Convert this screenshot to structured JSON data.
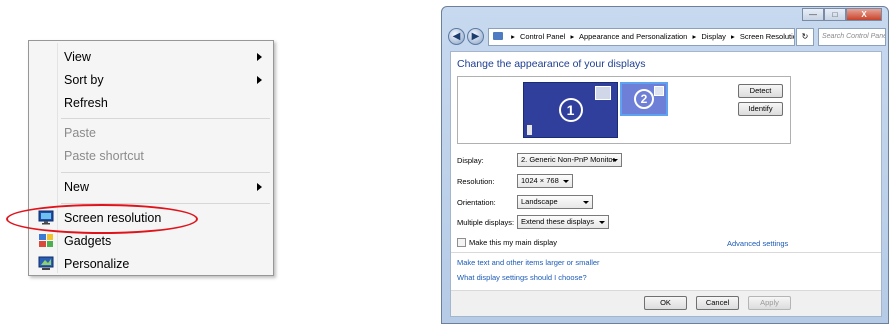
{
  "context_menu": {
    "items": [
      {
        "label": "View",
        "submenu": true
      },
      {
        "label": "Sort by",
        "submenu": true
      },
      {
        "label": "Refresh"
      },
      {
        "label": "Paste",
        "disabled": true
      },
      {
        "label": "Paste shortcut",
        "disabled": true
      },
      {
        "label": "New",
        "submenu": true
      },
      {
        "label": "Screen resolution",
        "icon": "screen-resolution-icon"
      },
      {
        "label": "Gadgets",
        "icon": "gadgets-icon"
      },
      {
        "label": "Personalize",
        "icon": "personalize-icon"
      }
    ],
    "highlight_color": "#e0121a"
  },
  "window": {
    "caption_buttons": {
      "minimize": "—",
      "maximize": "□",
      "close": "X"
    },
    "nav": {
      "back": "◀",
      "forward": "▶"
    },
    "breadcrumb": [
      "Control Panel",
      "Appearance and Personalization",
      "Display",
      "Screen Resolution"
    ],
    "refresh": "↻",
    "search_placeholder": "Search Control Panel",
    "title": "Change the appearance of your displays",
    "monitors": {
      "primary": "1",
      "secondary": "2"
    },
    "detect_label": "Detect",
    "identify_label": "Identify",
    "fields": {
      "display": {
        "label": "Display:",
        "value": "2. Generic Non-PnP Monitor"
      },
      "resolution": {
        "label": "Resolution:",
        "value": "1024 × 768"
      },
      "orientation": {
        "label": "Orientation:",
        "value": "Landscape"
      },
      "multiple": {
        "label": "Multiple displays:",
        "value": "Extend these displays"
      }
    },
    "main_display_checkbox": {
      "label": "Make this my main display",
      "checked": false
    },
    "advanced_link": "Advanced settings",
    "links": [
      "Make text and other items larger or smaller",
      "What display settings should I choose?"
    ],
    "buttons": {
      "ok": "OK",
      "cancel": "Cancel",
      "apply": "Apply"
    },
    "accent_color": "#1e3f91",
    "link_color": "#1c5bb6"
  }
}
